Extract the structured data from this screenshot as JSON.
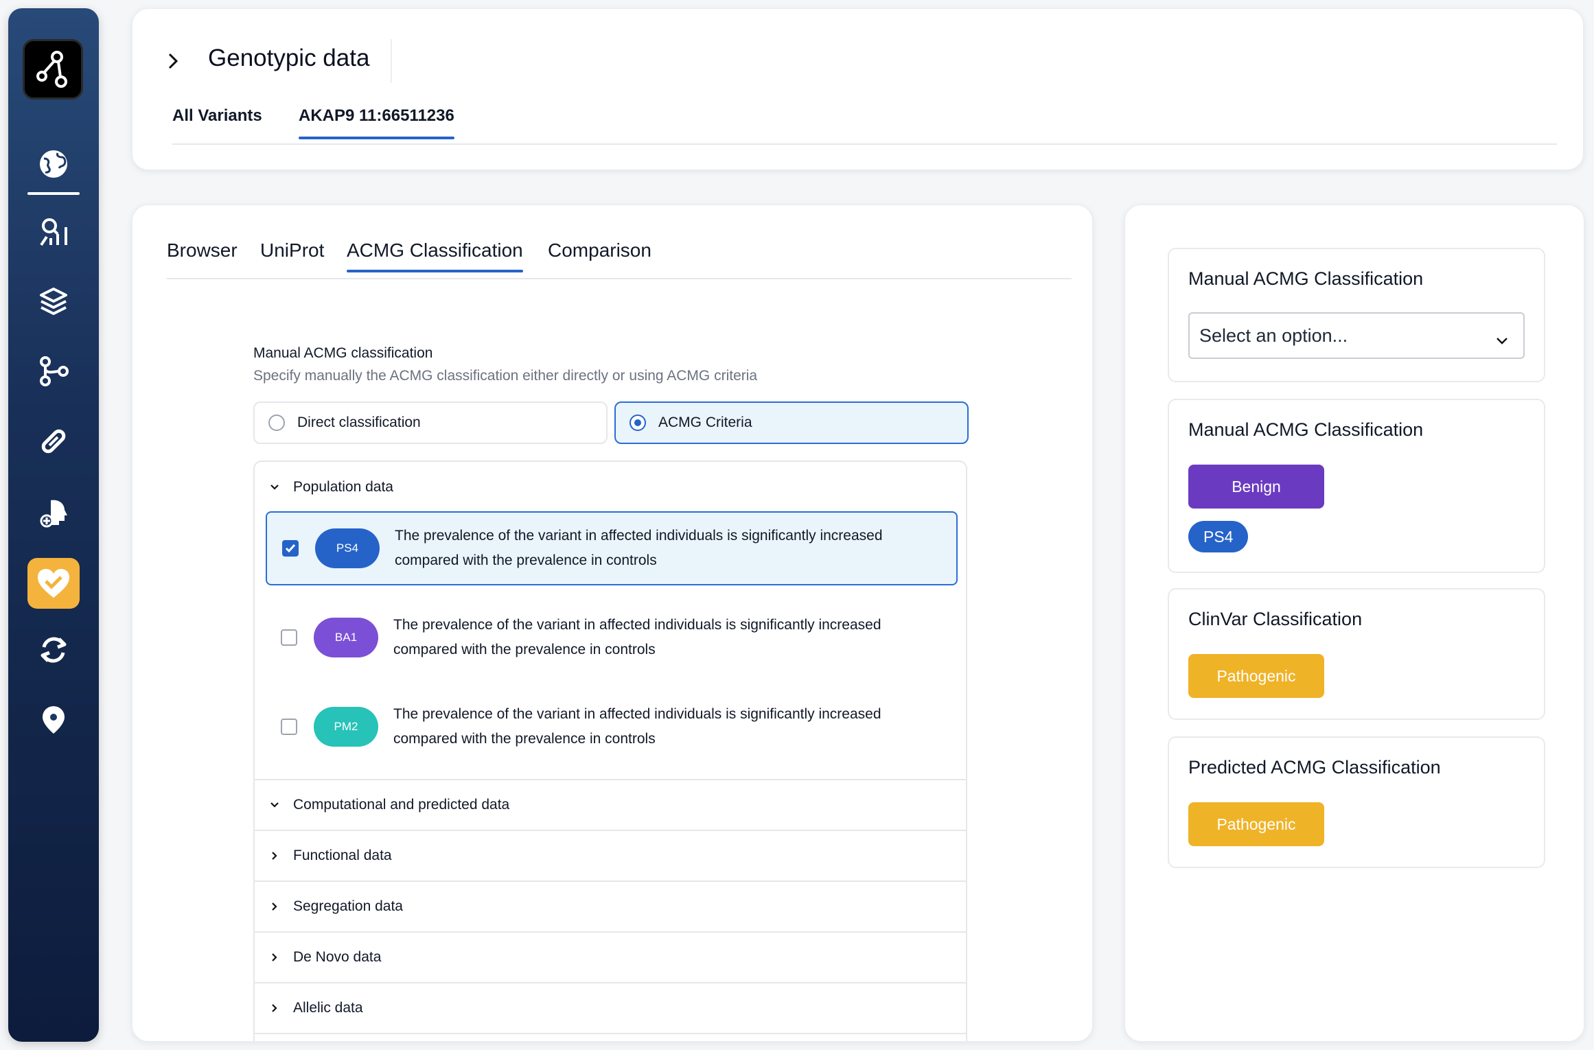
{
  "header": {
    "title": "Genotypic data",
    "tabs": [
      {
        "label": "All Variants"
      },
      {
        "label": "AKAP9 11:66511236"
      }
    ]
  },
  "main": {
    "tabs": [
      {
        "label": "Browser"
      },
      {
        "label": "UniProt"
      },
      {
        "label": "ACMG Classification"
      },
      {
        "label": "Comparison"
      }
    ],
    "section_title": "Manual ACMG classification",
    "section_subtitle": "Specify manually the ACMG classification either directly or using ACMG criteria",
    "radio_options": [
      {
        "label": "Direct classification",
        "selected": false
      },
      {
        "label": "ACMG Criteria",
        "selected": true
      }
    ],
    "accordion": {
      "population_label": "Population data",
      "criteria": [
        {
          "code": "PS4",
          "checked": true,
          "color": "#2563c9",
          "text": "The prevalence of the variant in affected individuals is significantly increased compared with the prevalence in controls"
        },
        {
          "code": "BA1",
          "checked": false,
          "color": "#7b4fd6",
          "text": "The prevalence of the variant in affected individuals is significantly increased compared with the prevalence in controls"
        },
        {
          "code": "PM2",
          "checked": false,
          "color": "#27c2b8",
          "text": "The prevalence of the variant in affected individuals is significantly increased compared with the prevalence in controls"
        }
      ],
      "sections": [
        {
          "label": "Computational and predicted data",
          "expanded": true
        },
        {
          "label": "Functional data",
          "expanded": false
        },
        {
          "label": "Segregation data",
          "expanded": false
        },
        {
          "label": "De Novo data",
          "expanded": false
        },
        {
          "label": "Allelic data",
          "expanded": false
        }
      ]
    }
  },
  "side": {
    "manual_select": {
      "title": "Manual ACMG Classification",
      "placeholder": "Select an option..."
    },
    "manual_result": {
      "title": "Manual ACMG Classification",
      "badge": "Benign",
      "badge_color": "#6a3bc1",
      "criterion": "PS4",
      "criterion_color": "#2563c9"
    },
    "clinvar": {
      "title": "ClinVar Classification",
      "badge": "Pathogenic",
      "badge_color": "#efb328"
    },
    "predicted": {
      "title": "Predicted ACMG Classification",
      "badge": "Pathogenic",
      "badge_color": "#efb328"
    }
  },
  "sidebar": {
    "icons": [
      "app-logo-icon",
      "globe-icon",
      "analytics-icon",
      "layers-icon",
      "branch-icon",
      "pill-icon",
      "head-plus-icon",
      "heart-check-icon",
      "sync-icon",
      "location-pin-icon"
    ],
    "active_color": "#f4b33c"
  }
}
